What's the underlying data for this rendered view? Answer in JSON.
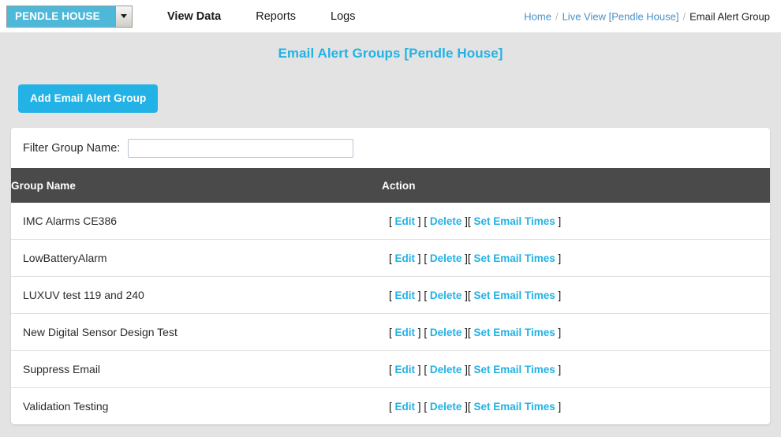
{
  "topbar": {
    "site_select": {
      "value": "PENDLE HOUSE",
      "arrow_icon": "chevron-down-icon"
    },
    "nav": [
      {
        "label": "View Data",
        "active": true
      },
      {
        "label": "Reports",
        "active": false
      },
      {
        "label": "Logs",
        "active": false
      }
    ],
    "breadcrumb": {
      "home": "Home",
      "live_view": "Live View [Pendle House]",
      "current": "Email Alert Group",
      "separator": "/"
    }
  },
  "page": {
    "title": "Email Alert Groups [Pendle House]",
    "add_button": "Add Email Alert Group"
  },
  "filter": {
    "label": "Filter Group Name:",
    "value": "",
    "placeholder": ""
  },
  "table": {
    "columns": [
      "Group Name",
      "Action"
    ],
    "actions": {
      "edit": "Edit",
      "delete": "Delete",
      "set_email_times": "Set Email Times",
      "bracket_open": "[",
      "bracket_close": "]"
    },
    "rows": [
      {
        "name": "IMC Alarms CE386"
      },
      {
        "name": "LowBatteryAlarm"
      },
      {
        "name": "LUXUV test 119 and 240"
      },
      {
        "name": "New Digital Sensor Design Test"
      },
      {
        "name": "Suppress Email"
      },
      {
        "name": "Validation Testing"
      }
    ]
  },
  "colors": {
    "accent": "#22b2e5",
    "site_select": "#4eb8d8",
    "table_header": "#4a4a4a",
    "page_background": "#e3e3e3",
    "breadcrumb_link": "#4a90c4"
  }
}
